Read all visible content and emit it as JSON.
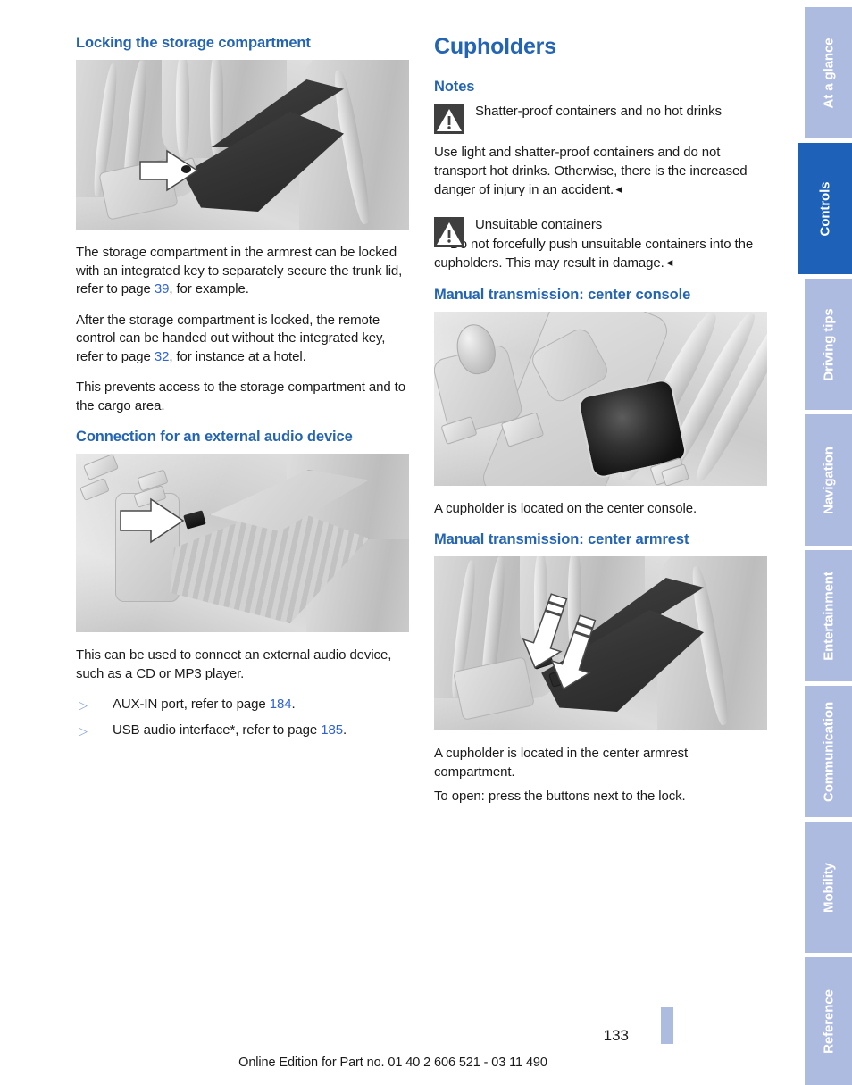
{
  "left_column": {
    "heading": "Locking the storage compartment",
    "figure_locking_alt": "armrest-storage-compartment-lock",
    "paragraphs": [
      {
        "pre": "The storage compartment in the armrest can be locked with an integrated key to separately secure the trunk lid, refer to page ",
        "ref": "39",
        "post": ", for example."
      },
      {
        "pre": "After the storage compartment is locked, the remote control can be handed out without the integrated key, refer to page ",
        "ref": "32",
        "post": ", for instance at a hotel."
      },
      {
        "pre": "This prevents access to the storage compartment and to the cargo area.",
        "ref": "",
        "post": ""
      }
    ],
    "audio_heading": "Connection for an external audio device",
    "figure_audio_alt": "open-center-console-aux-port",
    "audio_text": "This can be used to connect an external audio device, such as a CD or MP3 player.",
    "bullets": [
      {
        "marker": "▷",
        "pre": "AUX-IN port, refer to page ",
        "ref": "184",
        "post": "."
      },
      {
        "marker": "▷",
        "pre": "USB audio interface*, refer to page ",
        "ref": "185",
        "post": "."
      }
    ]
  },
  "right_column": {
    "title": "Cupholders",
    "notes_heading": "Notes",
    "notes": [
      {
        "icon": "warning-icon",
        "title": "Shatter-proof containers and no hot drinks",
        "body": "Use light and shatter-proof containers and do not transport hot drinks. Otherwise, there is the increased danger of injury in an accident.",
        "endmark": "◄"
      },
      {
        "icon": "warning-icon",
        "title": "Unsuitable containers",
        "body": "Do not forcefully push unsuitable containers into the cupholders. This may result in damage.",
        "endmark": "◄"
      }
    ],
    "console_heading": "Manual transmission: center console",
    "figure_console_alt": "center-console-cupholder",
    "console_text": "A cupholder is located on the center console.",
    "armrest_heading": "Manual transmission: center armrest",
    "figure_armrest_alt": "center-armrest-cupholder-buttons",
    "armrest_text_1": "A cupholder is located in the center armrest compartment.",
    "armrest_text_2": "To open: press the buttons next to the lock."
  },
  "tabs": [
    {
      "label": "At a glance",
      "active": false
    },
    {
      "label": "Controls",
      "active": true
    },
    {
      "label": "Driving tips",
      "active": false
    },
    {
      "label": "Navigation",
      "active": false
    },
    {
      "label": "Entertainment",
      "active": false
    },
    {
      "label": "Communication",
      "active": false
    },
    {
      "label": "Mobility",
      "active": false
    },
    {
      "label": "Reference",
      "active": false
    }
  ],
  "footer": {
    "page_number": "133",
    "edition_note": "Online Edition for Part no. 01 40 2 606 521 - 03 11 490"
  },
  "colors": {
    "accent_blue": "#2464b4",
    "tab_active": "#1d62b8",
    "tab_inactive": "#aebbe0",
    "link_blue": "#2f62d8"
  }
}
